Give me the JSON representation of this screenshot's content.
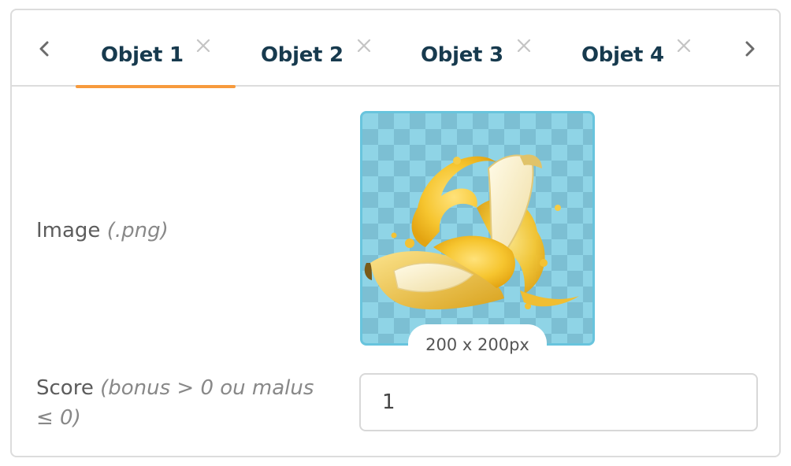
{
  "tabs": [
    {
      "label": "Objet 1",
      "active": true
    },
    {
      "label": "Objet 2",
      "active": false
    },
    {
      "label": "Objet 3",
      "active": false
    },
    {
      "label": "Objet 4",
      "active": false
    }
  ],
  "nav": {
    "prev_icon": "chevron-left-icon",
    "next_icon": "chevron-right-icon",
    "close_icon": "close-icon"
  },
  "form": {
    "image": {
      "label": "Image",
      "hint": "(.png)",
      "size_badge": "200 x 200px"
    },
    "score": {
      "label": "Score",
      "hint": "(bonus > 0 ou malus ≤ 0)",
      "value": "1"
    }
  },
  "colors": {
    "accent": "#f79a3c",
    "tab_text": "#173a4e",
    "image_border": "#68c4dd",
    "border": "#dcdcdc"
  }
}
